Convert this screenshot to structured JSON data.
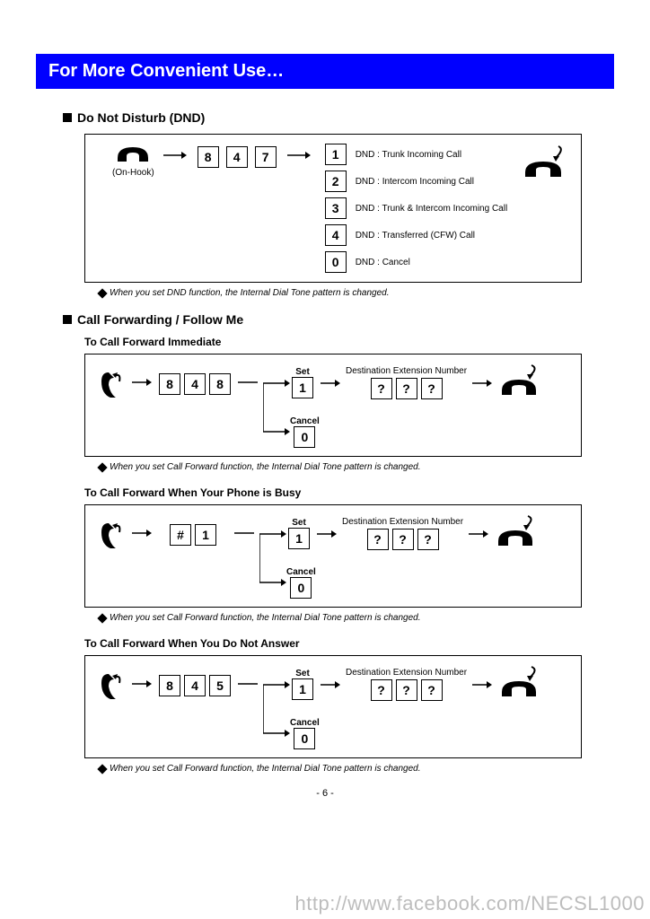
{
  "title": "For More Convenient Use…",
  "dnd": {
    "heading": "Do Not Disturb (DND)",
    "onhook_label": "(On-Hook)",
    "code": [
      "8",
      "4",
      "7"
    ],
    "options": [
      {
        "key": "1",
        "text": "DND : Trunk Incoming Call"
      },
      {
        "key": "2",
        "text": "DND : Intercom Incoming Call"
      },
      {
        "key": "3",
        "text": "DND : Trunk & Intercom Incoming Call"
      },
      {
        "key": "4",
        "text": "DND : Transferred (CFW) Call"
      },
      {
        "key": "0",
        "text": "DND : Cancel"
      }
    ],
    "note": "When you set DND function, the Internal Dial Tone pattern is changed."
  },
  "cf": {
    "heading": "Call Forwarding / Follow Me",
    "set_label": "Set",
    "cancel_label": "Cancel",
    "dest_label": "Destination Extension Number",
    "q": "?",
    "note": "When you set Call Forward function, the Internal Dial Tone pattern is changed.",
    "immediate": {
      "heading": "To Call Forward Immediate",
      "code": [
        "8",
        "4",
        "8"
      ],
      "set": "1",
      "cancel": "0"
    },
    "busy": {
      "heading": "To Call Forward When Your Phone is Busy",
      "code": [
        "#",
        "1"
      ],
      "set": "1",
      "cancel": "0"
    },
    "noanswer": {
      "heading": "To Call Forward When You Do Not Answer",
      "code": [
        "8",
        "4",
        "5"
      ],
      "set": "1",
      "cancel": "0"
    }
  },
  "page_number": "- 6 -",
  "watermark": "http://www.facebook.com/NECSL1000"
}
